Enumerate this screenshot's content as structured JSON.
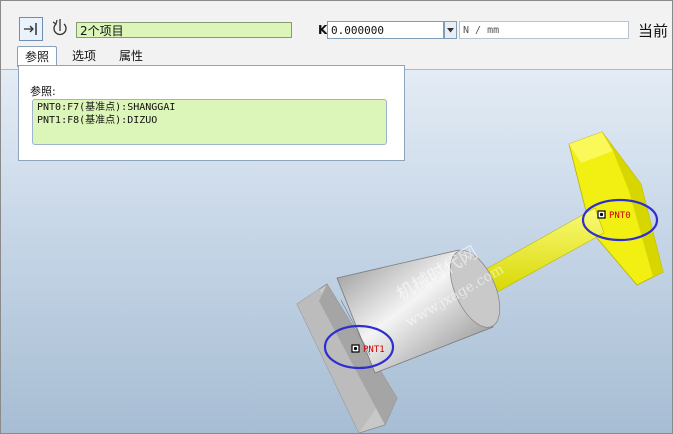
{
  "dashboard": {
    "collector_text": "2个项目",
    "value": "0.000000",
    "unit_placeholder": "N / mm",
    "title_partial": "当前",
    "tabs": [
      {
        "label": "参照"
      },
      {
        "label": "选项"
      },
      {
        "label": "属性"
      }
    ]
  },
  "references_panel": {
    "label": "参照:",
    "items": [
      {
        "text": "PNT0:F7(基准点):SHANGGAI"
      },
      {
        "text": "PNT1:F8(基准点):DIZUO"
      }
    ]
  },
  "model": {
    "points": [
      {
        "label": "PNT0"
      },
      {
        "label": "PNT1"
      }
    ],
    "watermark_cn": "机械时代网",
    "watermark_url": "www.jxage.com",
    "colors": {
      "cap": "#f2ef12",
      "rod": "#f2f20a",
      "base": "#bfbfbf",
      "highlight": "#3a3ad6"
    }
  }
}
